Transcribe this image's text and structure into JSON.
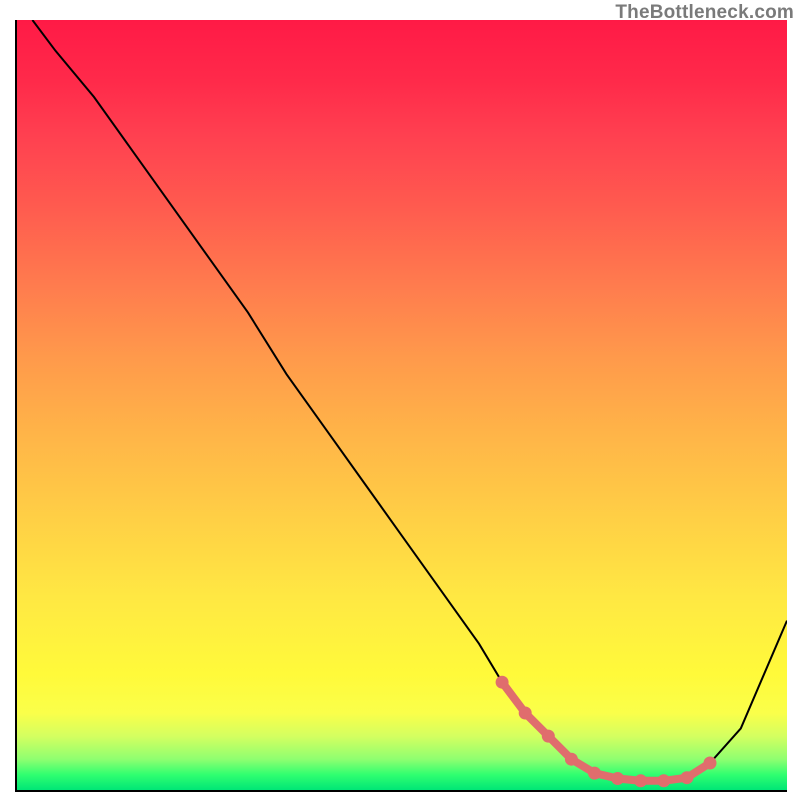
{
  "watermark": "TheBottleneck.com",
  "chart_data": {
    "type": "line",
    "title": "",
    "xlabel": "",
    "ylabel": "",
    "xlim": [
      0,
      100
    ],
    "ylim": [
      0,
      100
    ],
    "grid": false,
    "series": [
      {
        "name": "bottleneck-curve",
        "x": [
          2,
          5,
          10,
          15,
          20,
          25,
          30,
          35,
          40,
          45,
          50,
          55,
          60,
          63,
          66,
          69,
          72,
          75,
          78,
          81,
          84,
          87,
          90,
          94,
          100
        ],
        "values": [
          100,
          96,
          90,
          83,
          76,
          69,
          62,
          54,
          47,
          40,
          33,
          26,
          19,
          14,
          10,
          7,
          4,
          2.2,
          1.5,
          1.2,
          1.2,
          1.6,
          3.5,
          8,
          22
        ]
      },
      {
        "name": "optimal-markers",
        "x": [
          63,
          66,
          69,
          72,
          75,
          78,
          81,
          84,
          87,
          90
        ],
        "values": [
          14,
          10,
          7,
          4,
          2.2,
          1.5,
          1.2,
          1.2,
          1.6,
          3.5
        ]
      }
    ],
    "colors": {
      "curve": "#000000",
      "markers": "#e06d6d",
      "gradient_top": "#ff1a46",
      "gradient_bottom": "#00e676"
    }
  }
}
